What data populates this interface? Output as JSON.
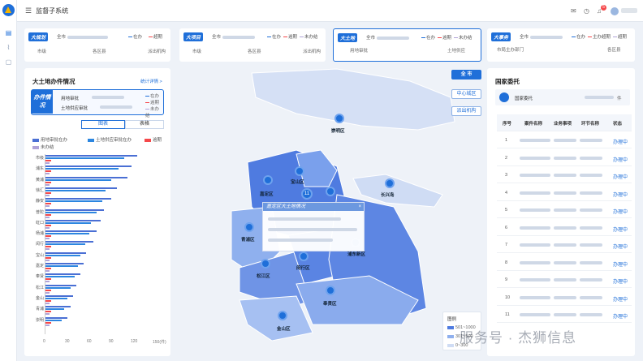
{
  "app": {
    "title": "监督子系统",
    "notif_count": "5"
  },
  "cards": {
    "c1": {
      "tag": "大规划",
      "scope": "全市",
      "s1": "在办",
      "s2": "超期",
      "cols": [
        "市级",
        "各区县",
        "派出机构"
      ]
    },
    "c2": {
      "tag": "大项目",
      "scope": "全市",
      "s1": "在办",
      "s2": "逾期",
      "s3": "未办结",
      "cols": [
        "市级",
        "各区县",
        "派出机构"
      ]
    },
    "c3": {
      "tag": "大土地",
      "scope": "全市",
      "s1": "在办",
      "s2": "逾期",
      "s3": "未办结",
      "cols": [
        "用地审批",
        "土地供应"
      ]
    },
    "c4": {
      "tag": "大事务",
      "scope": "全市",
      "s1": "在办",
      "s2": "主办超期",
      "s3": "超期",
      "cols": [
        "市局主办部门",
        "各区县"
      ]
    }
  },
  "left": {
    "title": "大土地办件情况",
    "detail_link": "统计详情 >",
    "summary_tag": "办件情况",
    "rows": [
      "用地审批",
      "土地供应审批"
    ],
    "status": [
      "在办",
      "逾期",
      "未办结"
    ],
    "toggle": [
      "图表",
      "表格"
    ],
    "legend": [
      "用地审批在办",
      "土地供应审批在办",
      "逾期",
      "未办结"
    ],
    "colors": {
      "a": "#4a6fd4",
      "b": "#2c86e0",
      "over": "#f5484a",
      "undone": "#b0a3d8"
    },
    "categories": [
      "市级",
      "浦东",
      "黄浦",
      "徐汇",
      "静安",
      "普陀",
      "虹口",
      "杨浦",
      "闵行",
      "宝山",
      "嘉定",
      "奉贤",
      "松江",
      "金山",
      "青浦",
      "崇明"
    ],
    "a_vals": [
      125,
      118,
      112,
      98,
      90,
      80,
      75,
      70,
      65,
      55,
      52,
      48,
      42,
      38,
      34,
      30
    ],
    "b_vals": [
      108,
      100,
      90,
      82,
      78,
      70,
      62,
      60,
      54,
      48,
      44,
      40,
      34,
      30,
      26,
      22
    ],
    "x_ticks": [
      "0",
      "30",
      "60",
      "90",
      "120",
      "150(件)"
    ],
    "x_max": 150
  },
  "map": {
    "btns": [
      "全 市",
      "中心城区",
      "派出机构"
    ],
    "districts": [
      "崇明区",
      "宝山区",
      "嘉定区",
      "青浦区",
      "松江区",
      "闵行区",
      "浦东新区",
      "奉贤区",
      "金山区",
      "长兴岛"
    ],
    "pin_badge": "11",
    "tooltip_title": "嘉定区大土地情况",
    "legend_title": "图例",
    "legend_items": [
      "501~1000",
      "301~500",
      "0~300"
    ]
  },
  "right": {
    "title": "国家委托",
    "tag": "国家委托",
    "unit": "件",
    "headers": [
      "序号",
      "案件名称",
      "业务事项",
      "环节名称",
      "状态"
    ],
    "rows": [
      "1",
      "2",
      "3",
      "4",
      "5",
      "6",
      "7",
      "8",
      "9",
      "10",
      "11"
    ],
    "status": "办理中"
  },
  "watermark": "服务号 · 杰狮信息"
}
